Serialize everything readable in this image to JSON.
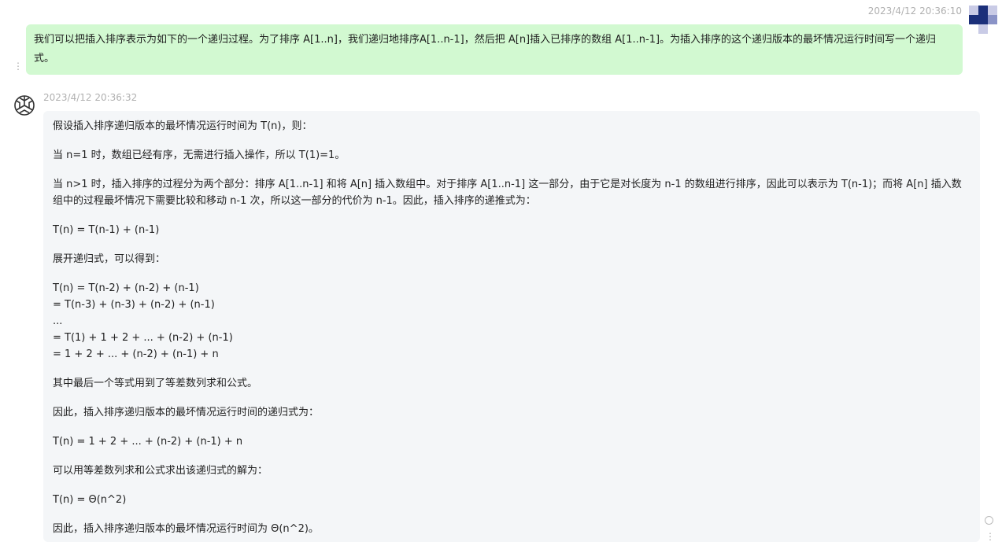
{
  "user_message": {
    "time": "2023/4/12 20:36:10",
    "text": "我们可以把插入排序表示为如下的一个递归过程。为了排序 A[1..n]，我们递归地排序A[1..n-1]，然后把 A[n]插入已排序的数组 A[1..n-1]。为插入排序的这个递归版本的最坏情况运行时间写一个递归式。"
  },
  "assistant_message": {
    "time": "2023/4/12 20:36:32",
    "lines": [
      "假设插入排序递归版本的最坏情况运行时间为 T(n)，则：",
      "当 n=1 时，数组已经有序，无需进行插入操作，所以 T(1)=1。",
      "当 n>1 时，插入排序的过程分为两个部分：排序 A[1..n-1] 和将 A[n] 插入数组中。对于排序 A[1..n-1] 这一部分，由于它是对长度为 n-1 的数组进行排序，因此可以表示为 T(n-1)；而将 A[n] 插入数组中的过程最坏情况下需要比较和移动 n-1 次，所以这一部分的代价为 n-1。因此，插入排序的递推式为：",
      "T(n) = T(n-1) + (n-1)",
      "展开递归式，可以得到：",
      "T(n) = T(n-2) + (n-2) + (n-1)",
      "= T(n-3) + (n-3) + (n-2) + (n-1)",
      "...",
      "= T(1) + 1 + 2 + ... + (n-2) + (n-1)",
      "= 1 + 2 + ... + (n-2) + (n-1) + n",
      "其中最后一个等式用到了等差数列求和公式。",
      "因此，插入排序递归版本的最坏情况运行时间的递归式为：",
      "T(n) = 1 + 2 + ... + (n-2) + (n-1) + n",
      "可以用等差数列求和公式求出该递归式的解为：",
      "T(n) = Θ(n^2)",
      "因此，插入排序递归版本的最坏情况运行时间为 Θ(n^2)。"
    ]
  },
  "icons": {
    "user_avatar": "user-avatar-icon",
    "bot_avatar": "openai-logo-icon",
    "more": "more-vertical-icon"
  },
  "colors": {
    "user_bubble": "#d2f9d1",
    "bot_bubble": "#f4f6f8",
    "timestamp": "#b0b0b0",
    "avatar_dark": "#1b2f7a"
  }
}
